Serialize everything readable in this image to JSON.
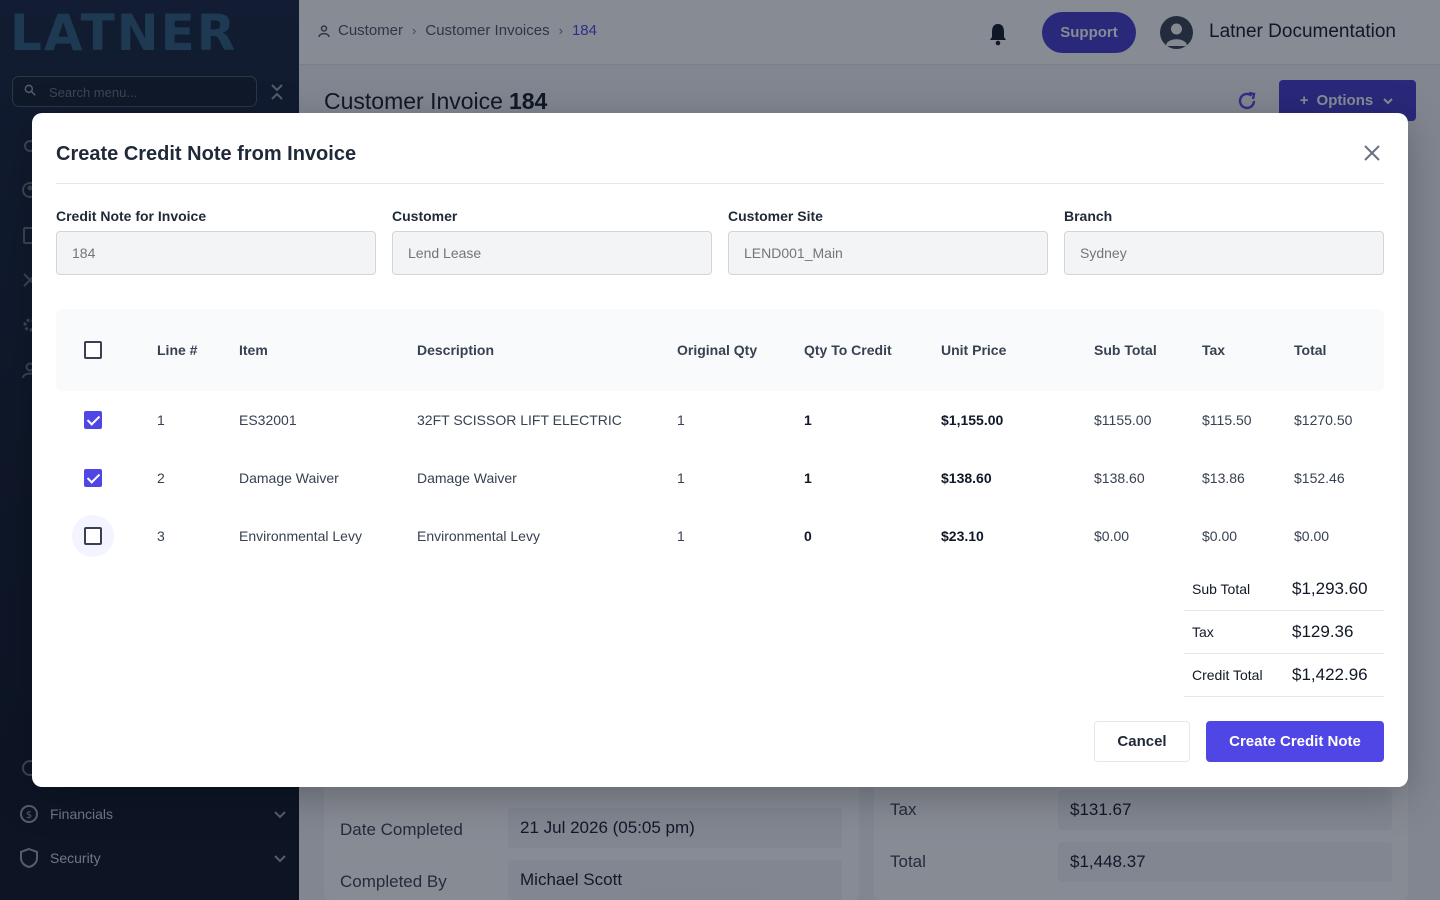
{
  "app": {
    "logo": "LATNER",
    "search_placeholder": "Search menu...",
    "sidebar_items": [
      {
        "label": "Financials",
        "icon": "dollar-refresh-icon"
      },
      {
        "label": "Security",
        "icon": "shield-icon"
      }
    ]
  },
  "topbar": {
    "breadcrumbs": [
      "Customer",
      "Customer Invoices",
      "184"
    ],
    "support_label": "Support",
    "user_name": "Latner Documentation"
  },
  "page": {
    "title": "Customer Invoice",
    "number": "184",
    "options_label": "Options",
    "details": {
      "date_completed_label": "Date Completed",
      "date_completed_value": "21 Jul 2026 (05:05 pm)",
      "completed_by_label": "Completed By",
      "completed_by_value": "Michael Scott",
      "tax_label": "Tax",
      "tax_value": "$131.67",
      "total_label": "Total",
      "total_value": "$1,448.37"
    }
  },
  "modal": {
    "title": "Create Credit Note from Invoice",
    "fields": [
      {
        "label": "Credit Note for Invoice",
        "placeholder": "184"
      },
      {
        "label": "Customer",
        "placeholder": "Lend Lease"
      },
      {
        "label": "Customer Site",
        "placeholder": "LEND001_Main"
      },
      {
        "label": "Branch",
        "placeholder": "Sydney"
      }
    ],
    "columns": [
      "Line #",
      "Item",
      "Description",
      "Original Qty",
      "Qty To Credit",
      "Unit Price",
      "Sub Total",
      "Tax",
      "Total"
    ],
    "rows": [
      {
        "checked": true,
        "line": "1",
        "item": "ES32001",
        "description": "32FT SCISSOR LIFT ELECTRIC",
        "original_qty": "1",
        "qty_to_credit": "1",
        "unit_price": "$1,155.00",
        "sub_total": "$1155.00",
        "tax": "$115.50",
        "total": "$1270.50"
      },
      {
        "checked": true,
        "line": "2",
        "item": "Damage Waiver",
        "description": "Damage Waiver",
        "original_qty": "1",
        "qty_to_credit": "1",
        "unit_price": "$138.60",
        "sub_total": "$138.60",
        "tax": "$13.86",
        "total": "$152.46"
      },
      {
        "checked": false,
        "line": "3",
        "item": "Environmental Levy",
        "description": "Environmental Levy",
        "original_qty": "1",
        "qty_to_credit": "0",
        "unit_price": "$23.10",
        "sub_total": "$0.00",
        "tax": "$0.00",
        "total": "$0.00"
      }
    ],
    "totals": {
      "sub_total_label": "Sub Total",
      "sub_total_value": "$1,293.60",
      "tax_label": "Tax",
      "tax_value": "$129.36",
      "credit_total_label": "Credit Total",
      "credit_total_value": "$1,422.96"
    },
    "cancel_label": "Cancel",
    "create_label": "Create Credit Note"
  },
  "colors": {
    "primary": "#4f46e5",
    "sidebar": "#0d1626",
    "overlay": "rgba(15,23,42,0.5)"
  }
}
